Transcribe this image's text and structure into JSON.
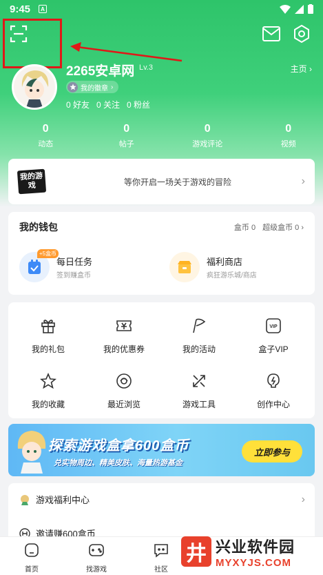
{
  "status_bar": {
    "time": "9:45",
    "badge": "A"
  },
  "profile": {
    "username": "2265安卓网",
    "level": "Lv.3",
    "homepage_label": "主页 ›",
    "badge_label": "我的徽章",
    "friends": "0 好友",
    "following": "0 关注",
    "followers": "0 粉丝"
  },
  "stats": [
    {
      "value": "0",
      "label": "动态"
    },
    {
      "value": "0",
      "label": "帖子"
    },
    {
      "value": "0",
      "label": "游戏评论"
    },
    {
      "value": "0",
      "label": "视频"
    }
  ],
  "game_card": {
    "logo": "我的游戏",
    "text": "等你开启一场关于游戏的冒险"
  },
  "wallet": {
    "title": "我的钱包",
    "coins": "盒币 0",
    "super_coins": "超级盒币 0 ›",
    "daily_task": {
      "title": "每日任务",
      "subtitle": "签到赚盒币",
      "tag": "+5盒币"
    },
    "shop": {
      "title": "福利商店",
      "subtitle": "疯狂游乐城/商店"
    }
  },
  "grid": [
    {
      "label": "我的礼包",
      "icon": "gift-icon"
    },
    {
      "label": "我的优惠券",
      "icon": "coupon-icon"
    },
    {
      "label": "我的活动",
      "icon": "flag-icon"
    },
    {
      "label": "盒子VIP",
      "icon": "vip-icon"
    },
    {
      "label": "我的收藏",
      "icon": "star-icon"
    },
    {
      "label": "最近浏览",
      "icon": "eye-icon"
    },
    {
      "label": "游戏工具",
      "icon": "tools-icon"
    },
    {
      "label": "创作中心",
      "icon": "creator-icon"
    }
  ],
  "banner": {
    "title": "探索游戏盒拿600盒币",
    "subtitle": "兑实物周边、精美皮肤、海量热游基金",
    "button": "立即参与"
  },
  "list": [
    {
      "label": "游戏福利中心"
    },
    {
      "label": "邀请赚600盒币"
    }
  ],
  "tabs": [
    {
      "label": "首页",
      "icon": "home-icon"
    },
    {
      "label": "找游戏",
      "icon": "gamepad-icon"
    },
    {
      "label": "社区",
      "icon": "community-icon"
    }
  ],
  "watermark": {
    "logo": "井",
    "cn": "兴业软件园",
    "en": "MYXYJS.COM"
  },
  "colors": {
    "brand_green": "#2ec46a",
    "highlight_red": "#e01818",
    "coin_orange": "#ff9a2e",
    "banner_yellow": "#ffe03a"
  }
}
